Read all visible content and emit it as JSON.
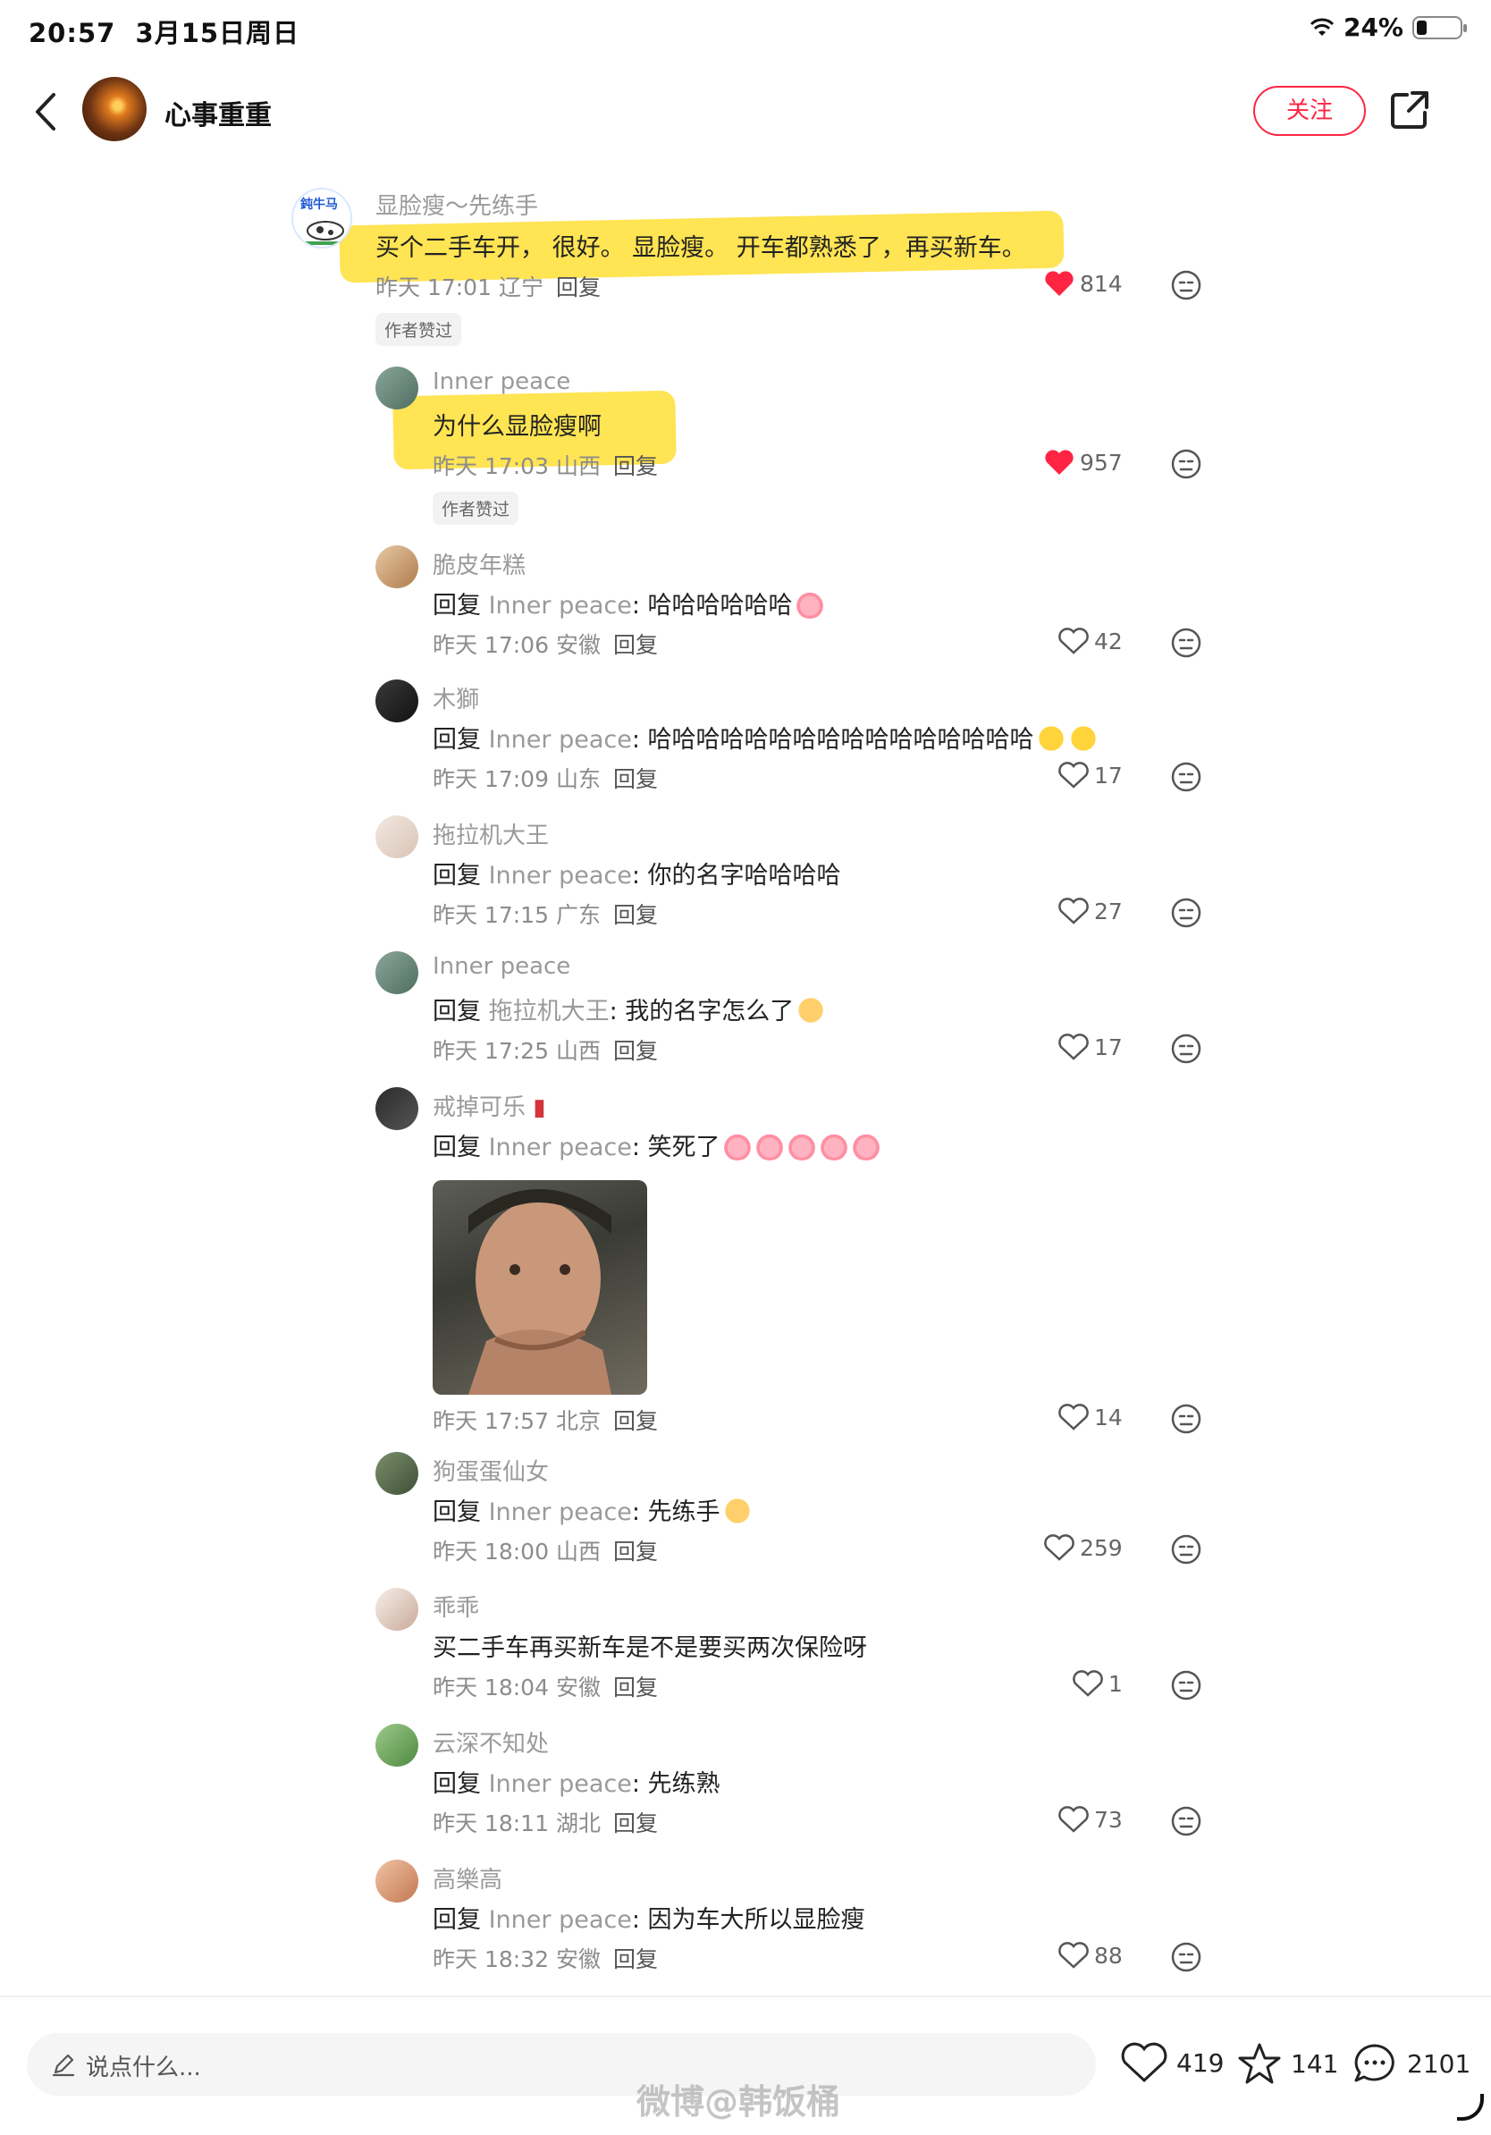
{
  "status_bar": {
    "time": "20:57",
    "date": "3月15日周日",
    "battery": "24%"
  },
  "header": {
    "title": "心事重重",
    "follow_label": "关注"
  },
  "author_liked_label": "作者赞过",
  "reply_prefix": "回复",
  "reply_label": "回复",
  "comments": [
    {
      "avatar_text": "鈍牛马",
      "name": "显脸瘦～先练手",
      "text": "买个二手车开， 很好。 显脸瘦。 开车都熟悉了，再买新车。",
      "time": "昨天 17:01 辽宁",
      "likes": "814",
      "liked": true
    },
    {
      "name": "Inner peace",
      "text": "为什么显脸瘦啊",
      "time": "昨天 17:03 山西",
      "likes": "957",
      "liked": true
    },
    {
      "name": "脆皮年糕",
      "target": "Inner peace",
      "text": "哈哈哈哈哈哈",
      "time": "昨天 17:06 安徽",
      "likes": "42"
    },
    {
      "name": "木獅",
      "target": "Inner peace",
      "text": "哈哈哈哈哈哈哈哈哈哈哈哈哈哈哈哈",
      "time": "昨天 17:09 山东",
      "likes": "17"
    },
    {
      "name": "拖拉机大王",
      "target": "Inner peace",
      "text": "你的名字哈哈哈哈",
      "time": "昨天 17:15 广东",
      "likes": "27"
    },
    {
      "name": "Inner peace",
      "target": "拖拉机大王",
      "text": "我的名字怎么了",
      "time": "昨天 17:25 山西",
      "likes": "17"
    },
    {
      "name": "戒掉可乐",
      "target": "Inner peace",
      "text": "笑死了",
      "time": "昨天 17:57 北京",
      "likes": "14"
    },
    {
      "name": "狗蛋蛋仙女",
      "target": "Inner peace",
      "text": "先练手",
      "time": "昨天 18:00 山西",
      "likes": "259"
    },
    {
      "name": "乖乖",
      "text": "买二手车再买新车是不是要买两次保险呀",
      "time": "昨天 18:04 安徽",
      "likes": "1"
    },
    {
      "name": "云深不知处",
      "target": "Inner peace",
      "text": "先练熟",
      "time": "昨天 18:11 湖北",
      "likes": "73"
    },
    {
      "name": "高樂高",
      "target": "Inner peace",
      "text": "因为车大所以显脸瘦",
      "time": "昨天 18:32 安徽",
      "likes": "88"
    }
  ],
  "bottom_bar": {
    "input_placeholder": "说点什么...",
    "likes": "419",
    "favorites": "141",
    "comments": "2101"
  },
  "watermark": "微博@韩饭桶",
  "colors": {
    "accent": "#ff2442",
    "highlight": "#ffe34a",
    "meta": "#8c8c8c"
  }
}
